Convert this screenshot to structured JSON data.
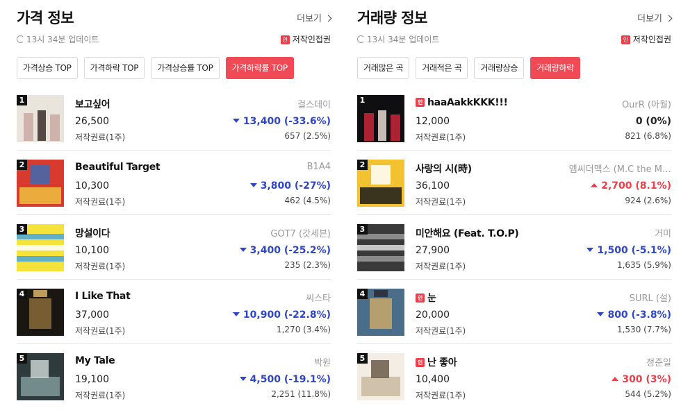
{
  "left": {
    "title": "가격 정보",
    "more_label": "더보기",
    "update_text": "13시 34분 업데이트",
    "copyright_badge": "인",
    "copyright_label": "저작인접권",
    "tabs": [
      {
        "label": "가격상승 TOP",
        "active": false
      },
      {
        "label": "가격하락 TOP",
        "active": false
      },
      {
        "label": "가격상승률 TOP",
        "active": false
      },
      {
        "label": "가격하락률 TOP",
        "active": true
      }
    ],
    "items": [
      {
        "rank": "1",
        "song": "보고싶어",
        "artist": "걸스데이",
        "price": "26,500",
        "change": "13,400 (-33.6%)",
        "direction": "down",
        "rights": "저작권료(1주)",
        "volume": "657 (2.5%)",
        "thumb_colors": [
          "#e9e4dc",
          "#c9a9a2",
          "#3a2e2a"
        ]
      },
      {
        "rank": "2",
        "song": "Beautiful Target",
        "artist": "B1A4",
        "price": "10,300",
        "change": "3,800 (-27%)",
        "direction": "down",
        "rights": "저작권료(1주)",
        "volume": "462 (4.5%)",
        "thumb_colors": [
          "#d83a2e",
          "#f0c040",
          "#3d6bb0"
        ]
      },
      {
        "rank": "3",
        "song": "망설이다",
        "artist": "GOT7 (갓세븐)",
        "price": "10,100",
        "change": "3,400 (-25.2%)",
        "direction": "down",
        "rights": "저작권료(1주)",
        "volume": "235 (2.3%)",
        "thumb_colors": [
          "#f5e23a",
          "#4aa8e0",
          "#ffffff"
        ]
      },
      {
        "rank": "4",
        "song": "I Like That",
        "artist": "씨스타",
        "price": "37,000",
        "change": "10,900 (-22.8%)",
        "direction": "down",
        "rights": "저작권료(1주)",
        "volume": "1,270 (3.4%)",
        "thumb_colors": [
          "#1a1612",
          "#8a6a3a",
          "#d9b36a"
        ]
      },
      {
        "rank": "5",
        "song": "My Tale",
        "artist": "박원",
        "price": "19,100",
        "change": "4,500 (-19.1%)",
        "direction": "down",
        "rights": "저작권료(1주)",
        "volume": "2,251 (11.8%)",
        "thumb_colors": [
          "#2e3a3c",
          "#7f9a98",
          "#c8d4d0"
        ]
      }
    ]
  },
  "right": {
    "title": "거래량 정보",
    "more_label": "더보기",
    "update_text": "13시 34분 업데이트",
    "copyright_badge": "인",
    "copyright_label": "저작인접권",
    "tabs": [
      {
        "label": "거래많은 곡",
        "active": false
      },
      {
        "label": "거래적은 곡",
        "active": false
      },
      {
        "label": "거래량상승",
        "active": false
      },
      {
        "label": "거래량하락",
        "active": true
      }
    ],
    "items": [
      {
        "rank": "1",
        "badge": "인",
        "song": "haaAakkKKK!!!",
        "artist": "OurR (아월)",
        "price": "12,000",
        "change": "0 (0%)",
        "direction": "flat",
        "rights": "저작권료(1주)",
        "volume": "821 (6.8%)",
        "thumb_colors": [
          "#0f0f12",
          "#c8263a",
          "#e8d9d2"
        ]
      },
      {
        "rank": "2",
        "song": "사랑의 시(時)",
        "artist": "엠씨더맥스 (M.C the M…",
        "price": "36,100",
        "change": "2,700 (8.1%)",
        "direction": "up",
        "rights": "저작권료(1주)",
        "volume": "924 (2.6%)",
        "thumb_colors": [
          "#f2c230",
          "#1a1a1a",
          "#ffffff"
        ]
      },
      {
        "rank": "3",
        "song": "미안해요 (Feat. T.O.P)",
        "artist": "거미",
        "price": "27,900",
        "change": "1,500 (-5.1%)",
        "direction": "down",
        "rights": "저작권료(1주)",
        "volume": "1,635 (5.9%)",
        "thumb_colors": [
          "#3a3a3a",
          "#9a9a9a",
          "#e0e0e0"
        ]
      },
      {
        "rank": "4",
        "badge": "인",
        "song": "눈",
        "artist": "SURL (설)",
        "price": "20,000",
        "change": "800 (-3.8%)",
        "direction": "down",
        "rights": "저작권료(1주)",
        "volume": "1,530 (7.7%)",
        "thumb_colors": [
          "#4a6d8a",
          "#c8a86a",
          "#2a2a36"
        ]
      },
      {
        "rank": "5",
        "badge": "인",
        "song": "난 좋아",
        "artist": "정준일",
        "price": "10,400",
        "change": "300 (3%)",
        "direction": "up",
        "rights": "저작권료(1주)",
        "volume": "544 (5.2%)",
        "thumb_colors": [
          "#f3ede4",
          "#c9b8a0",
          "#6a5a48"
        ]
      }
    ]
  }
}
